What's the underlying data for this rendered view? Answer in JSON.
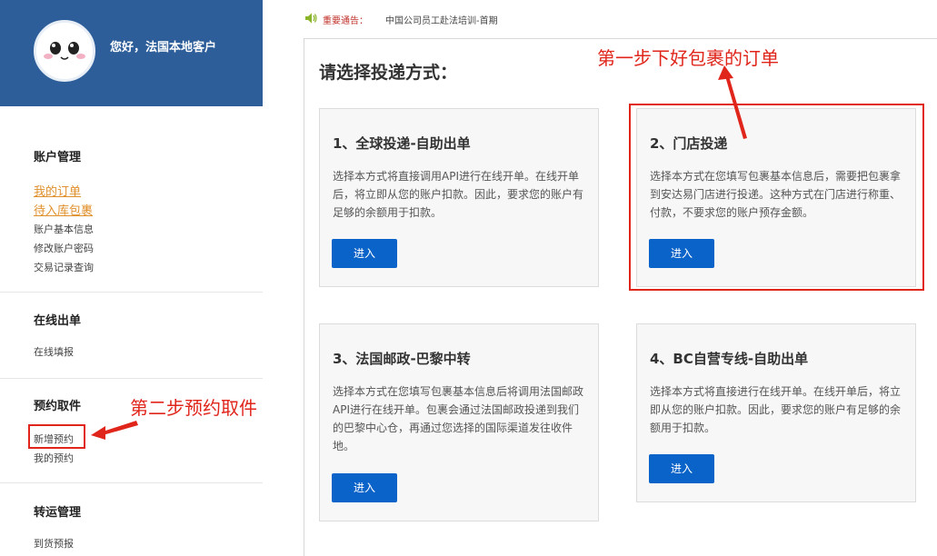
{
  "header": {
    "greeting": "您好，法国本地客户"
  },
  "sidebar": {
    "sections": [
      {
        "title": "账户管理",
        "items": [
          "我的订单",
          "待入库包裹",
          "账户基本信息",
          "修改账户密码",
          "交易记录查询"
        ]
      },
      {
        "title": "在线出单",
        "items": [
          "在线填报"
        ]
      },
      {
        "title": "预约取件",
        "items": [
          "新增预约",
          "我的预约"
        ]
      },
      {
        "title": "转运管理",
        "items": [
          "到货预报"
        ]
      }
    ]
  },
  "notice": {
    "label": "重要通告：",
    "text": "中国公司员工赴法培训-首期"
  },
  "main": {
    "title": "请选择投递方式：",
    "cards": [
      {
        "title": "1、全球投递-自助出单",
        "desc": "选择本方式将直接调用API进行在线开单。在线开单后，将立即从您的账户扣款。因此，要求您的账户有足够的余额用于扣款。",
        "button": "进入"
      },
      {
        "title": "2、门店投递",
        "desc": "选择本方式在您填写包裹基本信息后，需要把包裹拿到安达易门店进行投递。这种方式在门店进行称重、付款，不要求您的账户预存金额。",
        "button": "进入"
      },
      {
        "title": "3、法国邮政-巴黎中转",
        "desc": "选择本方式在您填写包裹基本信息后将调用法国邮政API进行在线开单。包裹会通过法国邮政投递到我们的巴黎中心仓，再通过您选择的国际渠道发往收件地。",
        "button": "进入"
      },
      {
        "title": "4、BC自营专线-自助出单",
        "desc": "选择本方式将直接进行在线开单。在线开单后，将立即从您的账户扣款。因此，要求您的账户有足够的余额用于扣款。",
        "button": "进入"
      }
    ]
  },
  "annotations": {
    "step1": "第一步下好包裹的订单",
    "step2": "第二步预约取件",
    "color": "#e0251b"
  }
}
